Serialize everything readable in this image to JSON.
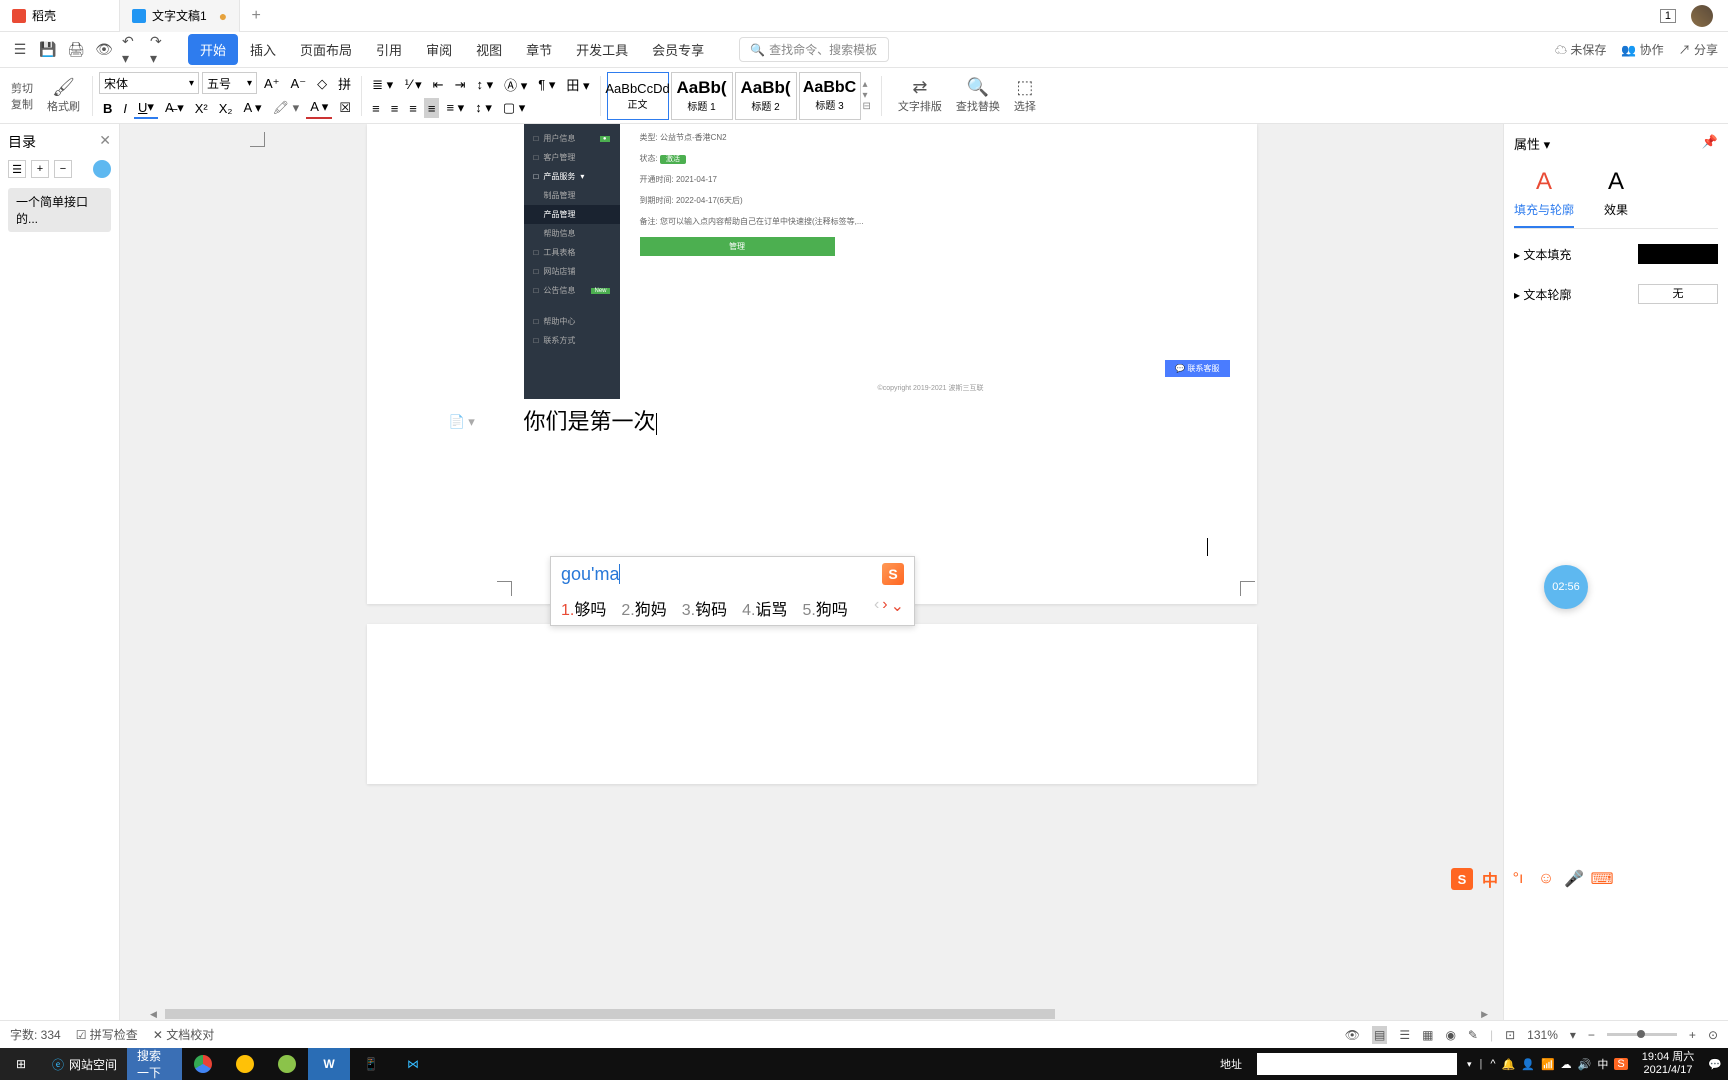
{
  "titlebar": {
    "tab1": "稻壳",
    "tab2": "文字文稿1",
    "indicator": "1"
  },
  "ribbon": {
    "tabs": [
      "开始",
      "插入",
      "页面布局",
      "引用",
      "审阅",
      "视图",
      "章节",
      "开发工具",
      "会员专享"
    ],
    "search_placeholder": "查找命令、搜索模板",
    "unsaved": "未保存",
    "collab": "协作",
    "share": "分享"
  },
  "toolbar": {
    "cut": "剪切",
    "copy": "复制",
    "brush": "格式刷",
    "font": "宋体",
    "size": "五号",
    "style_body": "正文",
    "style_h1": "标题 1",
    "style_h2": "标题 2",
    "style_h3": "标题 3",
    "style_sample": "AaBbCcDd",
    "style_sample_big": "AaBb(",
    "layout": "文字排版",
    "find": "查找替换",
    "select": "选择"
  },
  "nav": {
    "title": "目录",
    "item1": "一个简单接口的..."
  },
  "embed": {
    "menu_items": [
      "用户信息",
      "客户管理",
      "产品服务",
      "制品管理",
      "产品管理",
      "帮助信息",
      "工具表格",
      "网站店铺",
      "公告信息",
      "帮助中心",
      "联系方式"
    ],
    "new_badge": "New",
    "label_type": "类型: 公益节点-香港CN2",
    "label_status": "状态:",
    "status_val": "激活",
    "label_open": "开通时间:",
    "open_val": "2021-04-17",
    "label_expire": "到期时间:",
    "expire_val": "2022-04-17(6天后)",
    "note": "备注: 您可以输入点内容帮助自己在订单中快速搜(注释标签等,...",
    "manage_btn": "管理",
    "contact": "联系客服",
    "copyright": "©copyright 2019-2021 波斯三互联"
  },
  "document": {
    "text": "你们是第一次"
  },
  "ime": {
    "input": "gou'ma",
    "candidates": [
      {
        "num": "1.",
        "text": "够吗"
      },
      {
        "num": "2.",
        "text": "狗妈"
      },
      {
        "num": "3.",
        "text": "钩码"
      },
      {
        "num": "4.",
        "text": "诟骂"
      },
      {
        "num": "5.",
        "text": "狗吗"
      }
    ]
  },
  "props": {
    "title": "属性",
    "tab_fill": "填充与轮廓",
    "tab_effect": "效果",
    "text_fill": "文本填充",
    "text_outline": "文本轮廓",
    "none": "无"
  },
  "timer": "02:56",
  "float": {
    "lang": "中"
  },
  "status": {
    "words": "字数: 334",
    "spell": "拼写检查",
    "proof": "文档校对",
    "zoom": "131%"
  },
  "taskbar": {
    "web": "网站空间",
    "search": "搜索一下",
    "addr_label": "地址",
    "lang": "中",
    "time": "19:04",
    "day": "周六",
    "date": "2021/4/17"
  }
}
